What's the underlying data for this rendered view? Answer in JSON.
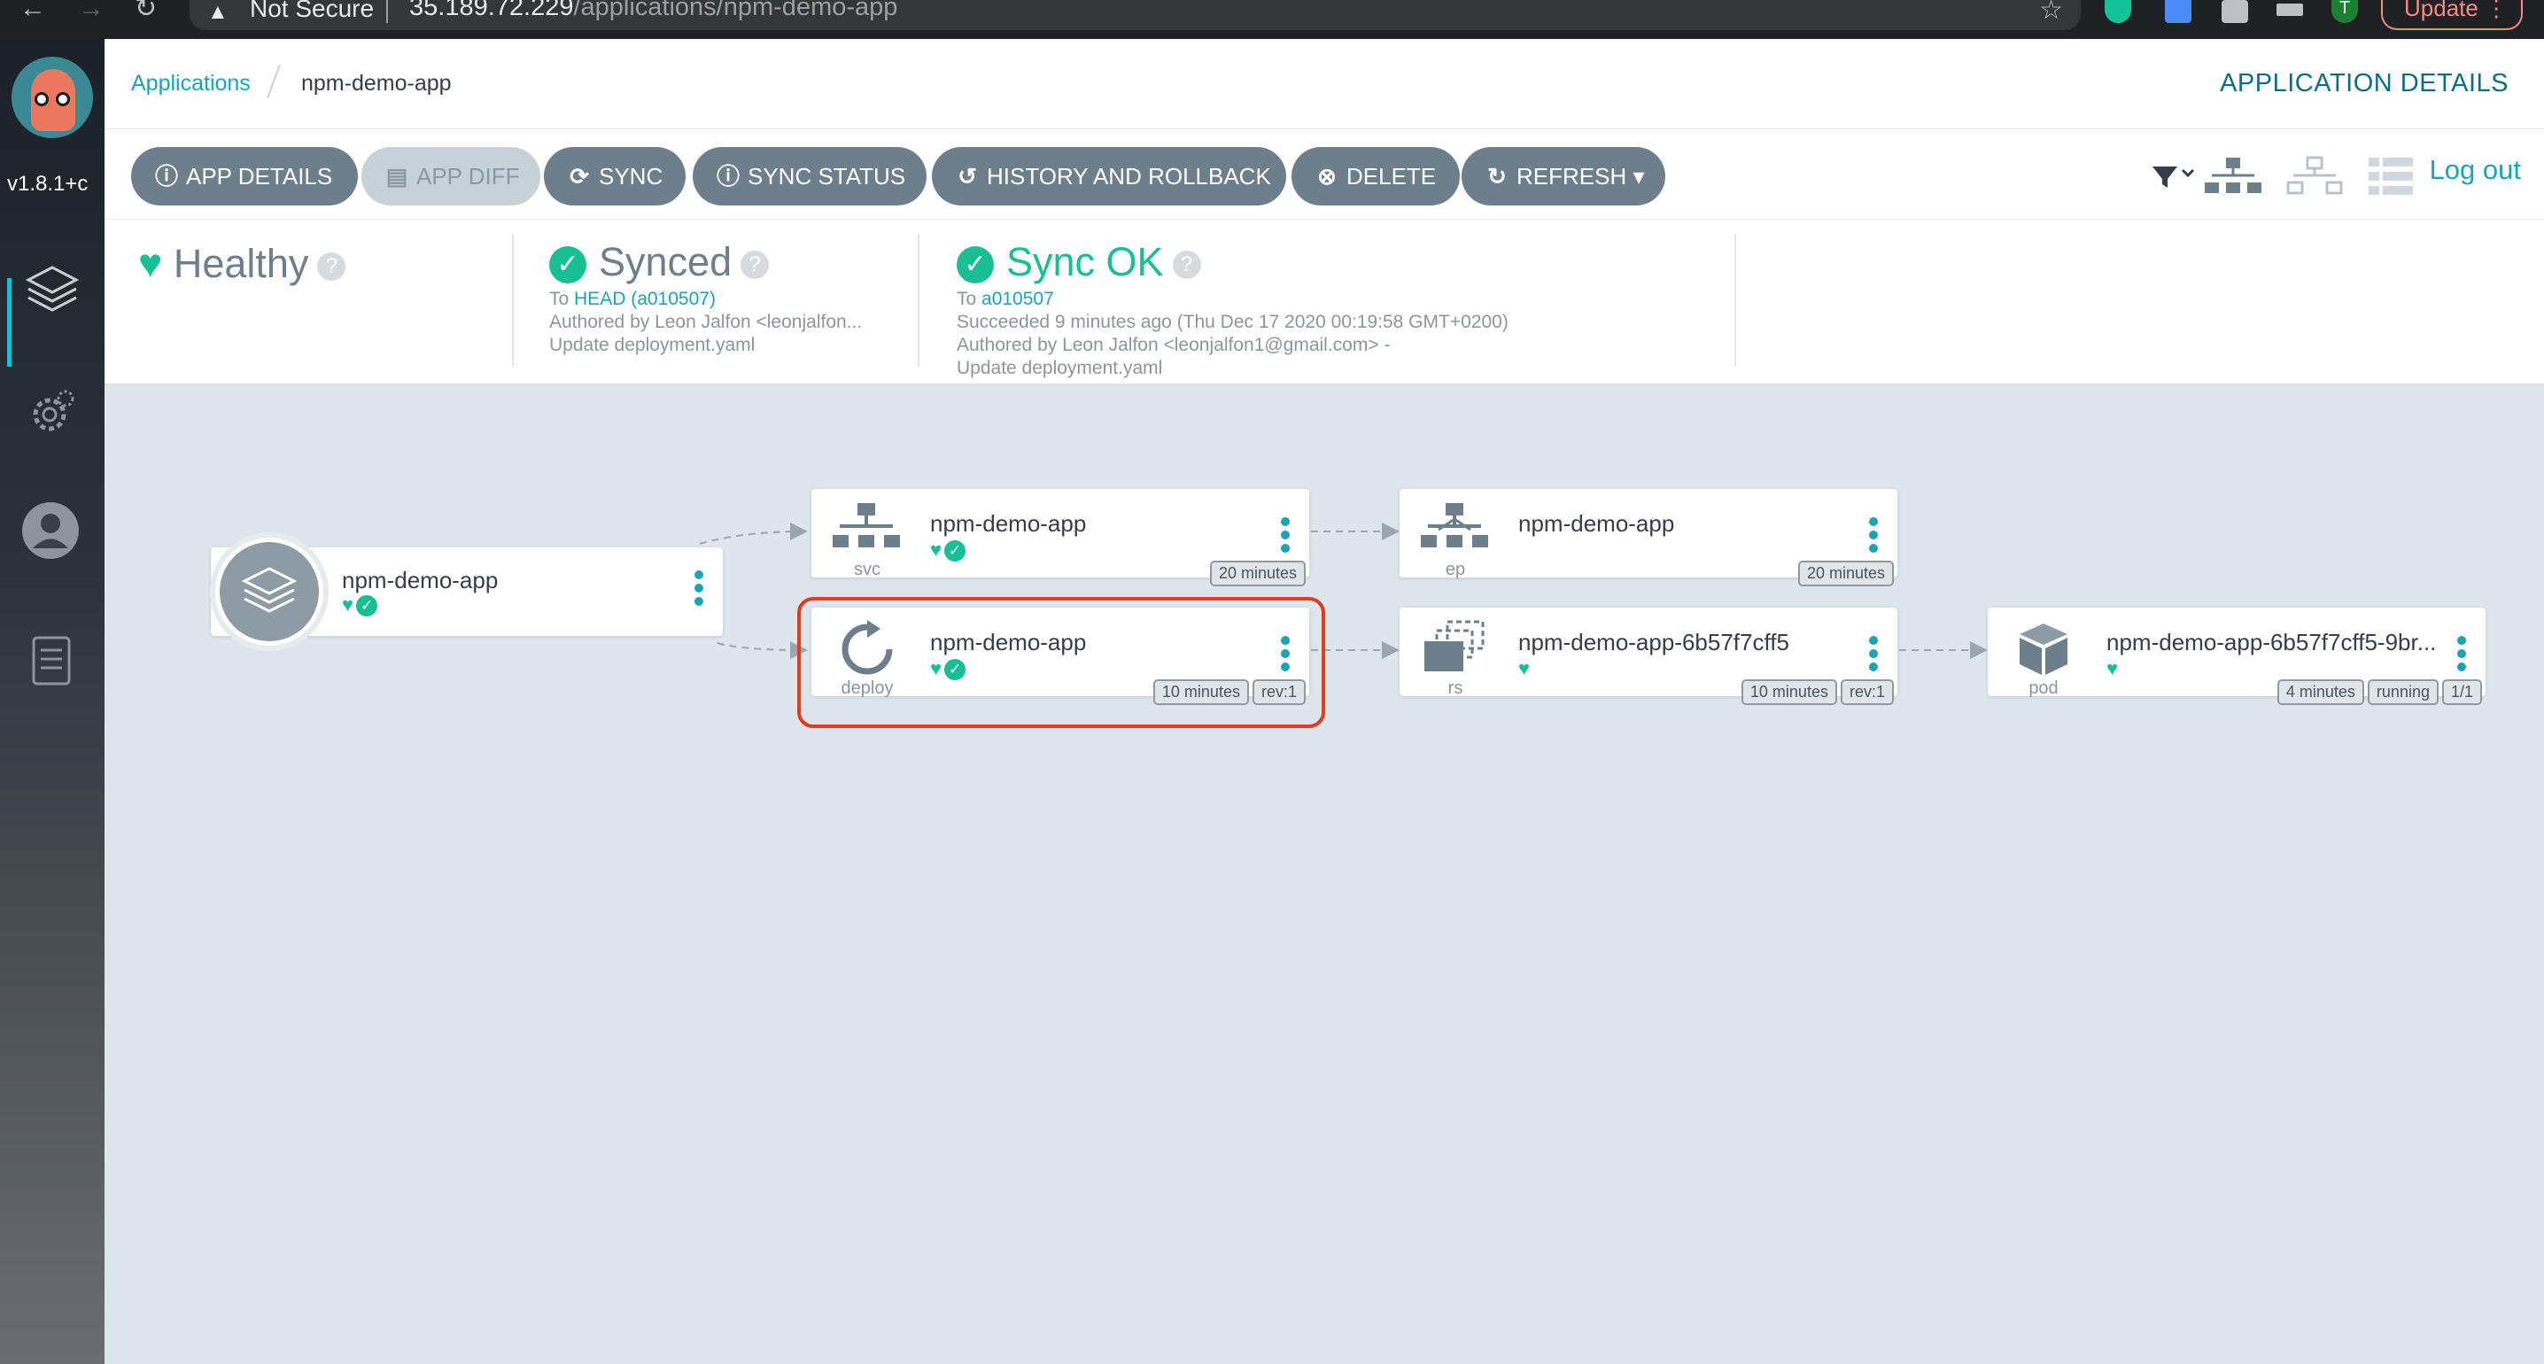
{
  "browser": {
    "security_label": "Not Secure",
    "url_host": "35.189.72.229",
    "url_path": "/applications/npm-demo-app",
    "profile_initial": "T",
    "update_label": "Update"
  },
  "sidebar": {
    "version": "v1.8.1+c"
  },
  "header": {
    "breadcrumb_root": "Applications",
    "breadcrumb_current": "npm-demo-app",
    "title": "APPLICATION DETAILS"
  },
  "toolbar": {
    "buttons": [
      {
        "label": "APP DETAILS",
        "icon": "info-icon"
      },
      {
        "label": "APP DIFF",
        "icon": "file-diff-icon"
      },
      {
        "label": "SYNC",
        "icon": "sync-icon"
      },
      {
        "label": "SYNC STATUS",
        "icon": "info-icon"
      },
      {
        "label": "HISTORY AND ROLLBACK",
        "icon": "history-icon"
      },
      {
        "label": "DELETE",
        "icon": "delete-icon"
      },
      {
        "label": "REFRESH",
        "icon": "refresh-icon"
      }
    ],
    "logout_label": "Log out"
  },
  "status": {
    "health": {
      "label": "Healthy"
    },
    "sync": {
      "label": "Synced",
      "to_prefix": "To ",
      "to_revision": "HEAD (a010507)",
      "author": "Authored by Leon Jalfon <leonjalfon...",
      "message": "Update deployment.yaml"
    },
    "operation": {
      "label": "Sync OK",
      "to_prefix": "To ",
      "to_revision": "a010507",
      "succeeded": "Succeeded 9 minutes ago (Thu Dec 17 2020 00:19:58 GMT+0200)",
      "author": "Authored by Leon Jalfon <leonjalfon1@gmail.com> -",
      "message": "Update deployment.yaml"
    }
  },
  "graph": {
    "app": {
      "name": "npm-demo-app"
    },
    "svc": {
      "name": "npm-demo-app",
      "kind": "svc",
      "tags": [
        "20 minutes"
      ]
    },
    "deploy": {
      "name": "npm-demo-app",
      "kind": "deploy",
      "tags": [
        "10 minutes",
        "rev:1"
      ]
    },
    "ep": {
      "name": "npm-demo-app",
      "kind": "ep",
      "tags": [
        "20 minutes"
      ]
    },
    "rs": {
      "name": "npm-demo-app-6b57f7cff5",
      "kind": "rs",
      "tags": [
        "10 minutes",
        "rev:1"
      ]
    },
    "pod": {
      "name": "npm-demo-app-6b57f7cff5-9br...",
      "kind": "pod",
      "tags": [
        "4 minutes",
        "running",
        "1/1"
      ]
    }
  },
  "colors": {
    "accent": "#1ba3b6",
    "healthy": "#18be94",
    "highlight": "#e53924",
    "button": "#6d7f8b"
  }
}
